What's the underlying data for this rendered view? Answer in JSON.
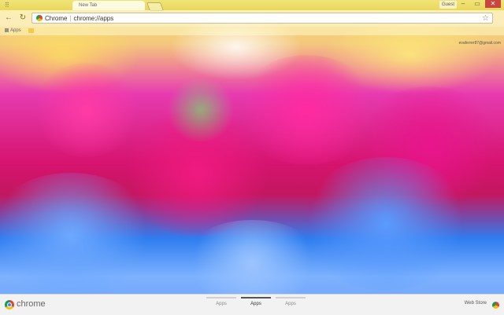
{
  "window": {
    "tab_title": "New Tab",
    "profile_name": "Guest",
    "minimize_icon": "minimize-icon",
    "restore_icon": "restore-icon",
    "close_icon": "close-icon"
  },
  "toolbar": {
    "back_icon": "back-arrow-icon",
    "reload_icon": "reload-icon",
    "omnibox": {
      "site_label": "Chrome",
      "url": "chrome://apps"
    },
    "bookmark_icon": "star-icon"
  },
  "bookmarks": {
    "apps_label": "Apps"
  },
  "account": {
    "email": "evaferrer87@gmail.com"
  },
  "bottom_bar": {
    "brand": "chrome",
    "pages": [
      {
        "label": "Apps",
        "active": false
      },
      {
        "label": "Apps",
        "active": true
      },
      {
        "label": "Apps",
        "active": false
      }
    ],
    "web_store": "Web Store"
  },
  "colors": {
    "accent": "#f4e36a",
    "close": "#c9463d",
    "bottom_bar": "#f2f2f2"
  }
}
